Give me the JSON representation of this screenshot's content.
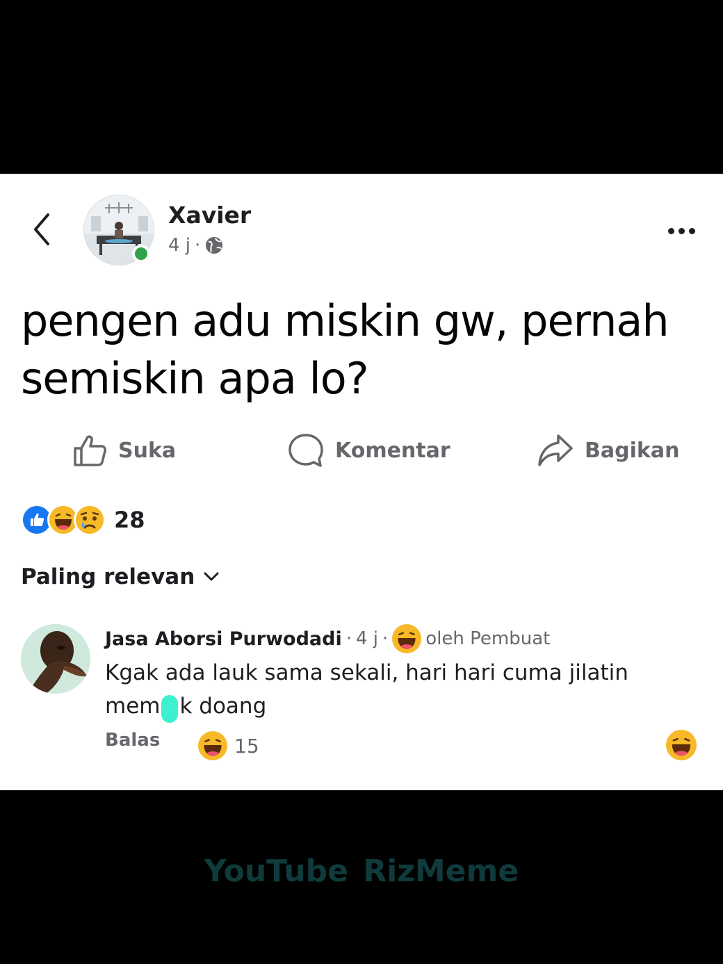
{
  "post": {
    "author": "Xavier",
    "time": "4 j",
    "separator": "·",
    "text": "pengen adu miskin gw, pernah semiskin apa lo?"
  },
  "actions": {
    "like": "Suka",
    "comment": "Komentar",
    "share": "Bagikan"
  },
  "reactions": {
    "icons": [
      "like-icon",
      "haha-icon",
      "sad-icon"
    ],
    "count": "28"
  },
  "sort": {
    "label": "Paling relevan"
  },
  "comment": {
    "author": "Jasa Aborsi Purwodadi",
    "time": "4 j",
    "separator": "·",
    "reacted_by": "oleh Pembuat",
    "text_before": "Kgak ada lauk sama sekali, hari hari cuma jilatin mem",
    "text_after": "k doang",
    "reply": "Balas",
    "reaction_count": "15"
  },
  "watermark": "YouTube RizMeme",
  "colors": {
    "like_blue": "#1877f2",
    "emoji_yellow": "#f7b928",
    "online_green": "#31a24c",
    "censor": "#3ff0d0",
    "watermark": "#0f3b3c"
  }
}
